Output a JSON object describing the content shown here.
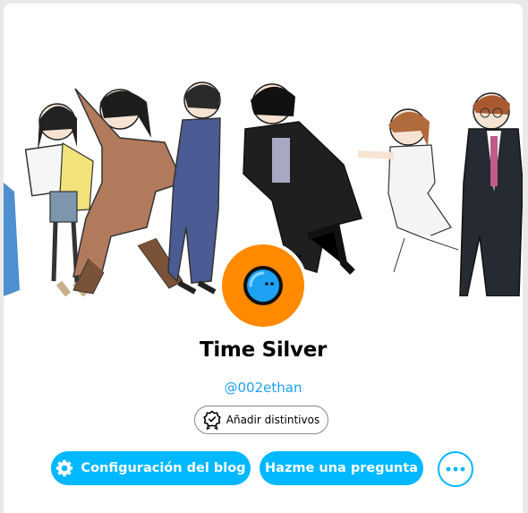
{
  "profile": {
    "title": "Time Silver",
    "handle": "@002ethan"
  },
  "header_image": {
    "description_icon": "banner-illustration"
  },
  "avatar": {
    "icon": "avatar-icon",
    "background_color": "#ff8a00",
    "face_color": "#1da1f2"
  },
  "actions": {
    "badges_label": "Añadir distintivos",
    "badges_icon": "badge-icon",
    "settings_label": "Configuración del blog",
    "settings_icon": "gear-icon",
    "ask_label": "Hazme una pregunta",
    "more_icon": "more-icon"
  },
  "colors": {
    "accent": "#00b8ff",
    "handle": "#1da1f2"
  }
}
